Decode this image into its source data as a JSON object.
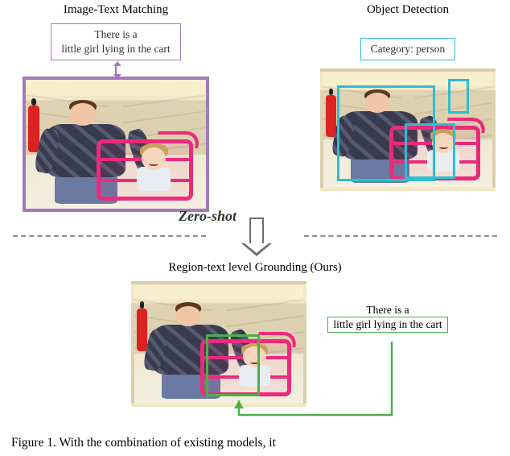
{
  "top": {
    "left": {
      "title": "Image-Text Matching",
      "caption_line1": "There is a",
      "caption_line2": "little girl lying in the cart"
    },
    "right": {
      "title": "Object Detection",
      "category_label": "Category: person"
    }
  },
  "middle": {
    "zero_shot": "Zero-shot"
  },
  "bottom": {
    "title": "Region-text level Grounding (Ours)",
    "callout_line1": "There is a",
    "callout_line2": "little girl lying in the cart"
  },
  "colors": {
    "purple": "#a07ab8",
    "cyan": "#2fbdd2",
    "green": "#4daf4a",
    "magenta_cart": "#ec2a7b"
  },
  "icons": {
    "double_arrow": "double-arrow-vertical",
    "down_arrow": "hollow-down-arrow"
  },
  "caption": {
    "prefix": "Figure 1. ",
    "text_fragment": "With the combination of existing models, it"
  }
}
